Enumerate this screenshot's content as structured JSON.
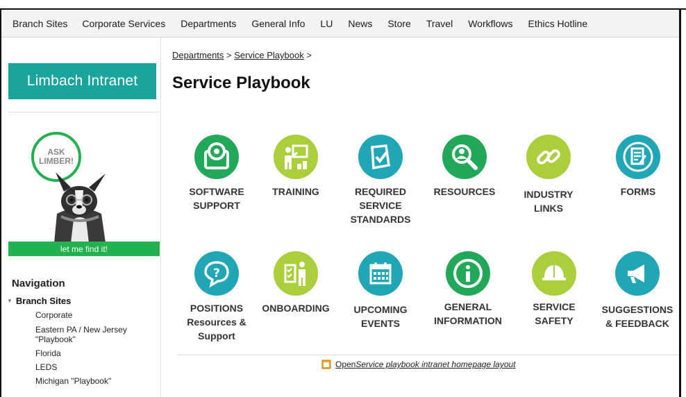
{
  "topnav": {
    "items": [
      "Branch Sites",
      "Corporate Services",
      "Departments",
      "General Info",
      "LU",
      "News",
      "Store",
      "Travel",
      "Workflows",
      "Ethics Hotline"
    ]
  },
  "sidebar": {
    "brand": "Limbach Intranet",
    "promo": {
      "bubble_text": "ASK LIMBER!",
      "find_label": "let me find it!"
    },
    "nav_title": "Navigation",
    "branch_label": "Branch Sites",
    "branch_items": [
      "Corporate",
      "Eastern PA / New Jersey \"Playbook\"",
      "Florida",
      "LEDS",
      "Michigan \"Playbook\""
    ]
  },
  "breadcrumb": {
    "part1": "Departments",
    "sep1": " > ",
    "part2": "Service Playbook",
    "sep2": " >"
  },
  "page": {
    "title": "Service Playbook"
  },
  "tiles": [
    {
      "label": "SOFTWARE SUPPORT",
      "icon": "software-icon",
      "color": "#22a859"
    },
    {
      "label": "TRAINING",
      "icon": "training-icon",
      "color": "#a9cf3c"
    },
    {
      "label": "REQUIRED SERVICE STANDARDS",
      "icon": "checklist-icon",
      "color": "#20a6b4"
    },
    {
      "label": "RESOURCES",
      "icon": "magnifier-icon",
      "color": "#22a859"
    },
    {
      "label": "INDUSTRY LINKS",
      "icon": "link-icon",
      "color": "#a9cf3c"
    },
    {
      "label": "FORMS",
      "icon": "form-icon",
      "color": "#20a6b4"
    },
    {
      "label": "POSITIONS Resources & Support",
      "icon": "question-icon",
      "color": "#20a6b4"
    },
    {
      "label": "ONBOARDING",
      "icon": "onboarding-icon",
      "color": "#a9cf3c"
    },
    {
      "label": "UPCOMING EVENTS",
      "icon": "calendar-icon",
      "color": "#20a6b4"
    },
    {
      "label": "GENERAL INFORMATION",
      "icon": "info-icon",
      "color": "#22a859"
    },
    {
      "label": "SERVICE SAFETY",
      "icon": "hardhat-icon",
      "color": "#a9cf3c"
    },
    {
      "label": "SUGGESTIONS & FEEDBACK",
      "icon": "megaphone-icon",
      "color": "#20a6b4"
    }
  ],
  "footer": {
    "link_prefix": "Open ",
    "link_em": "Service playbook intranet homepage layout"
  }
}
